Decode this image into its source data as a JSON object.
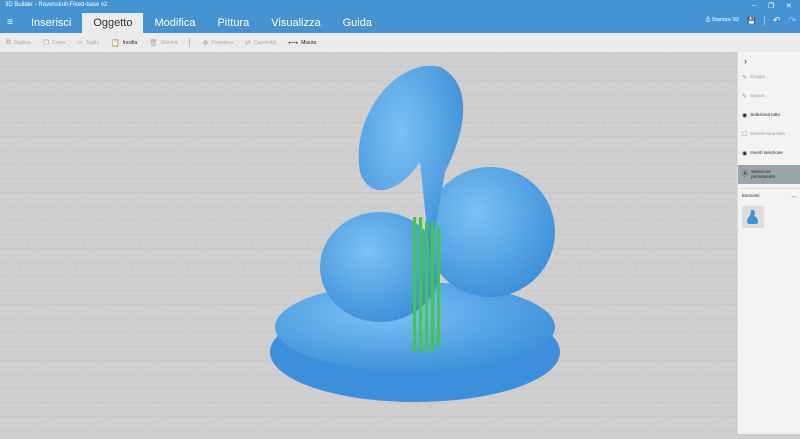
{
  "window": {
    "title": "3D Builder - Ravenskull-Fixed-base v2",
    "minimize": "–",
    "maximize": "❐",
    "close": "✕"
  },
  "menu": {
    "hamburger": "≡",
    "tabs": [
      {
        "label": "Inserisci"
      },
      {
        "label": "Oggetto"
      },
      {
        "label": "Modifica"
      },
      {
        "label": "Pittura"
      },
      {
        "label": "Visualizza"
      },
      {
        "label": "Guida"
      }
    ]
  },
  "topright": {
    "print_label": "Stampa 3D",
    "save_icon": "💾",
    "undo": "↶",
    "redo": "↷"
  },
  "toolbar": {
    "items": [
      {
        "icon": "⧉",
        "label": "Duplica"
      },
      {
        "icon": "❐",
        "label": "Copia"
      },
      {
        "icon": "✂",
        "label": "Taglia"
      },
      {
        "icon": "📋",
        "label": "Incolla"
      },
      {
        "icon": "🗑",
        "label": "Elimina"
      },
      {
        "icon": "✥",
        "label": "Posiziona"
      },
      {
        "icon": "⇄",
        "label": "Capovolgi"
      },
      {
        "icon": "⟷",
        "label": "Misura"
      }
    ]
  },
  "panel": {
    "collapse": "›",
    "items": [
      {
        "icon": "✎",
        "label": "Gruppo"
      },
      {
        "icon": "✎",
        "label": "Separa"
      },
      {
        "icon": "◉",
        "label": "Seleziona tutto"
      },
      {
        "icon": "☐",
        "label": "Deseleziona tutto"
      },
      {
        "icon": "◉",
        "label": "Inverti selezione"
      },
      {
        "icon": "Ⓐ",
        "label": "Selezione permanente"
      }
    ],
    "elements_label": "Elementi",
    "elements_chevron": "︿"
  },
  "colors": {
    "accent": "#4593d3",
    "model": "#4a9ee6",
    "support": "#45c83c"
  }
}
